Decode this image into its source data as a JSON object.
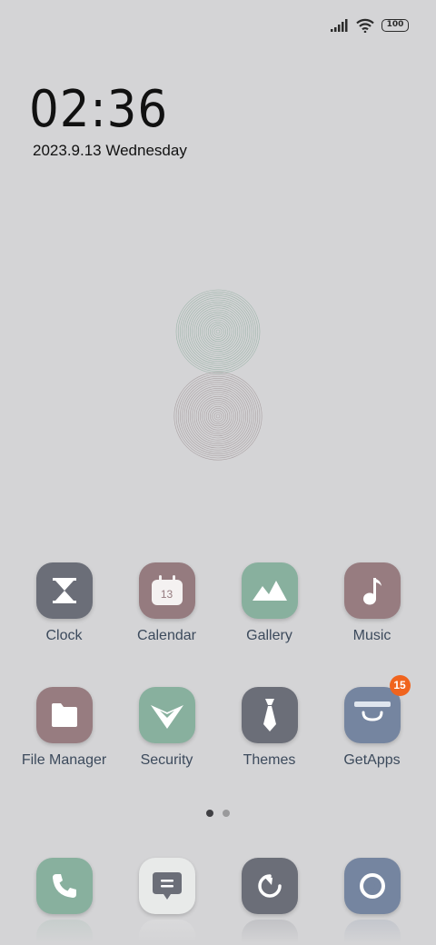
{
  "status_bar": {
    "signal_icon": "signal-bars-icon",
    "wifi_icon": "wifi-icon",
    "battery_level": "100"
  },
  "clock_widget": {
    "time": "02:36",
    "date": "2023.9.13 Wednesday"
  },
  "home_apps": [
    {
      "label": "Clock",
      "icon": "hourglass-icon",
      "color": "#6b6e78"
    },
    {
      "label": "Calendar",
      "icon": "calendar-icon",
      "color": "#957b7f",
      "calendar_day": "13"
    },
    {
      "label": "Gallery",
      "icon": "mountain-icon",
      "color": "#88b09e"
    },
    {
      "label": "Music",
      "icon": "music-note-icon",
      "color": "#977c80"
    },
    {
      "label": "File Manager",
      "icon": "folder-icon",
      "color": "#977c80"
    },
    {
      "label": "Security",
      "icon": "shield-check-icon",
      "color": "#88b09e"
    },
    {
      "label": "Themes",
      "icon": "tie-icon",
      "color": "#6b6e78"
    },
    {
      "label": "GetApps",
      "icon": "shopping-bag-icon",
      "color": "#7585a0",
      "badge": "15"
    }
  ],
  "page_indicator": {
    "pages": 2,
    "current": 1
  },
  "dock": [
    {
      "name": "phone",
      "icon": "phone-icon",
      "color": "#88b09e"
    },
    {
      "name": "messages",
      "icon": "message-icon",
      "color": "#e8eae9"
    },
    {
      "name": "browser",
      "icon": "compass-icon",
      "color": "#6b6e78"
    },
    {
      "name": "camera",
      "icon": "camera-icon",
      "color": "#7585a0"
    }
  ]
}
